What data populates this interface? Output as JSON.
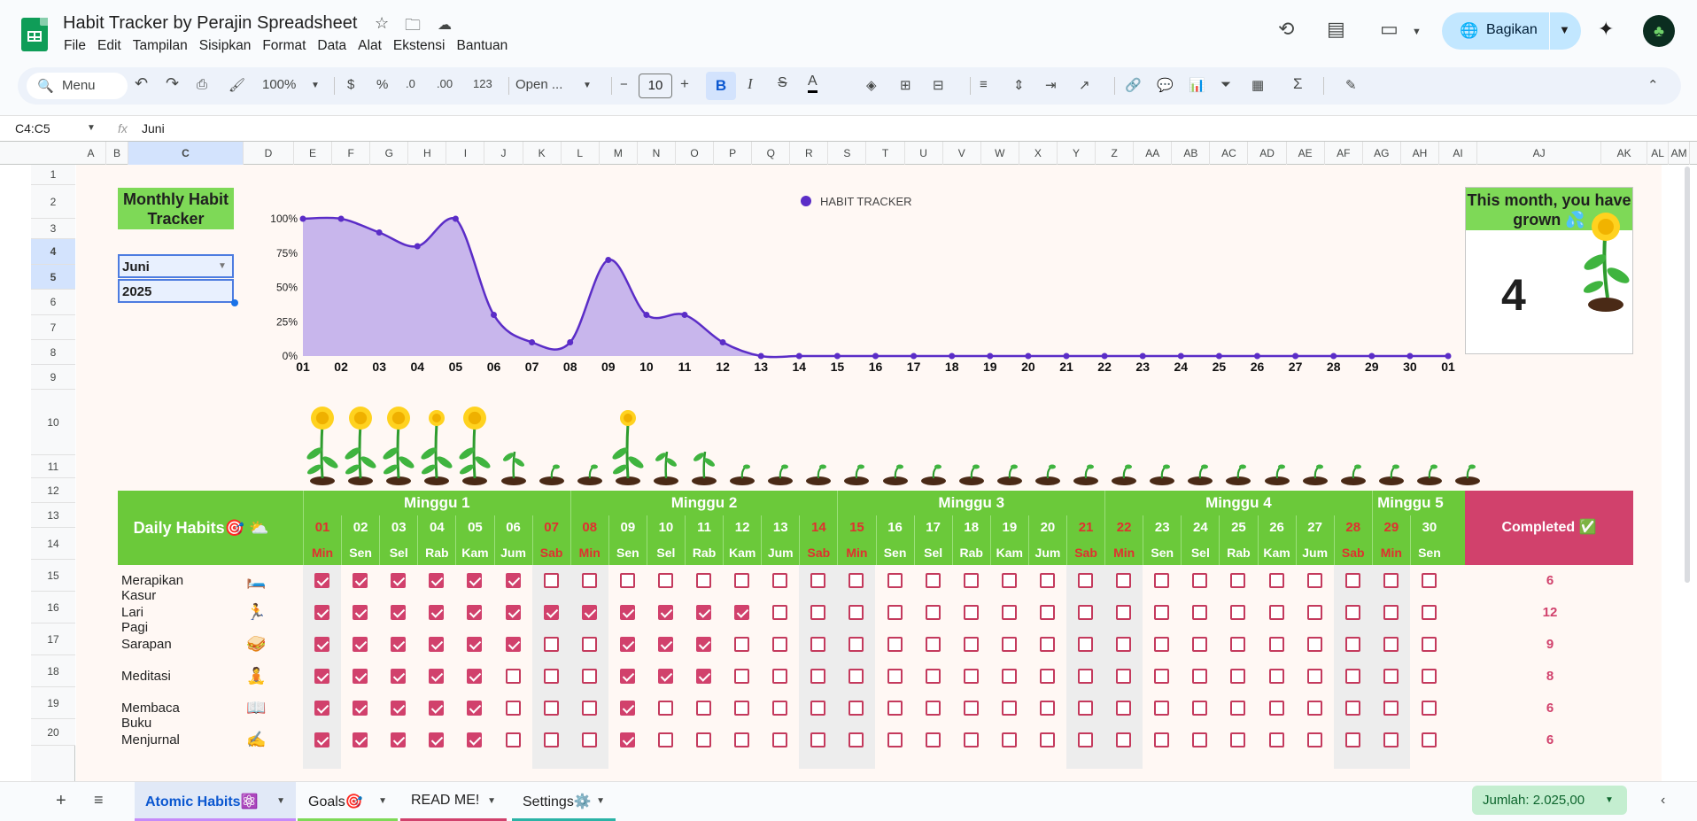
{
  "app": {
    "title": "Habit Tracker by Perajin Spreadsheet",
    "share_label": "Bagikan"
  },
  "menu": [
    "File",
    "Edit",
    "Tampilan",
    "Sisipkan",
    "Format",
    "Data",
    "Alat",
    "Ekstensi",
    "Bantuan"
  ],
  "toolbar": {
    "search": "Menu",
    "zoom": "100%",
    "currency": "$",
    "percent": "%",
    "dec_dec": ".0",
    "dec_inc": ".00",
    "num_fmt": "123",
    "font": "Open ...",
    "font_size": "10"
  },
  "formula": {
    "namebox": "C4:C5",
    "fx": "fx",
    "content": "Juni"
  },
  "columns": [
    "A",
    "B",
    "C",
    "D",
    "E",
    "F",
    "G",
    "H",
    "I",
    "J",
    "K",
    "L",
    "M",
    "N",
    "O",
    "P",
    "Q",
    "R",
    "S",
    "T",
    "U",
    "V",
    "W",
    "X",
    "Y",
    "Z",
    "AA",
    "AB",
    "AC",
    "AD",
    "AE",
    "AF",
    "AG",
    "AH",
    "AI",
    "AJ",
    "AK",
    "AL",
    "AM"
  ],
  "rows": [
    "1",
    "2",
    "3",
    "4",
    "5",
    "6",
    "7",
    "8",
    "9",
    "10",
    "11",
    "12",
    "13",
    "14",
    "15",
    "16",
    "17",
    "18",
    "19",
    "20"
  ],
  "tracker": {
    "title": "Monthly Habit Tracker",
    "month": "Juni",
    "year": "2025",
    "grown_title": "This month, you have grown 💦",
    "grown_value": "4"
  },
  "chart_data": {
    "type": "area",
    "title": "",
    "legend": [
      "HABIT TRACKER"
    ],
    "legend_position": "top-center",
    "x": [
      "01",
      "02",
      "03",
      "04",
      "05",
      "06",
      "07",
      "08",
      "09",
      "10",
      "11",
      "12",
      "13",
      "14",
      "15",
      "16",
      "17",
      "18",
      "19",
      "20",
      "21",
      "22",
      "23",
      "24",
      "25",
      "26",
      "27",
      "28",
      "29",
      "30",
      "01"
    ],
    "series": [
      {
        "name": "HABIT TRACKER",
        "values": [
          100,
          100,
          90,
          80,
          100,
          30,
          10,
          10,
          70,
          30,
          30,
          10,
          0,
          0,
          0,
          0,
          0,
          0,
          0,
          0,
          0,
          0,
          0,
          0,
          0,
          0,
          0,
          0,
          0,
          0,
          0
        ]
      }
    ],
    "yticks": [
      "0%",
      "25%",
      "50%",
      "75%",
      "100%"
    ],
    "ylim": [
      0,
      100
    ],
    "colors": {
      "line": "#5b2dc7",
      "fill": "#c8b6ec"
    }
  },
  "plants": [
    "flower",
    "flower",
    "flower",
    "budflower",
    "flower",
    "sprout",
    "seed",
    "seed",
    "budflower",
    "sprout",
    "sprout",
    "seed",
    "seed",
    "seed",
    "seed",
    "seed",
    "seed",
    "seed",
    "seed",
    "seed",
    "seed",
    "seed",
    "seed",
    "seed",
    "seed",
    "seed",
    "seed",
    "seed",
    "seed",
    "seed",
    "seed"
  ],
  "habits": {
    "header": "Daily Habits🎯 ⛅",
    "completed_label": "Completed ✅",
    "weeks": [
      "Minggu 1",
      "Minggu 2",
      "Minggu 3",
      "Minggu 4",
      "Minggu 5"
    ],
    "week_spans": [
      7,
      7,
      7,
      7,
      2
    ],
    "days": [
      "01",
      "02",
      "03",
      "04",
      "05",
      "06",
      "07",
      "08",
      "09",
      "10",
      "11",
      "12",
      "13",
      "14",
      "15",
      "16",
      "17",
      "18",
      "19",
      "20",
      "21",
      "22",
      "23",
      "24",
      "25",
      "26",
      "27",
      "28",
      "29",
      "30"
    ],
    "weekdays": [
      "Min",
      "Sen",
      "Sel",
      "Rab",
      "Kam",
      "Jum",
      "Sab",
      "Min",
      "Sen",
      "Sel",
      "Rab",
      "Kam",
      "Jum",
      "Sab",
      "Min",
      "Sen",
      "Sel",
      "Rab",
      "Kam",
      "Jum",
      "Sab",
      "Min",
      "Sen",
      "Sel",
      "Rab",
      "Kam",
      "Jum",
      "Sab",
      "Min",
      "Sen"
    ],
    "rows": [
      {
        "name": "Merapikan Kasur",
        "icon": "🛏️",
        "checks": "111111000000000000000000000000",
        "completed": "6"
      },
      {
        "name": "Lari Pagi",
        "icon": "🏃",
        "checks": "111111111111000000000000000000",
        "completed": "12"
      },
      {
        "name": "Sarapan",
        "icon": "🥪",
        "checks": "111111001110000000000000000000",
        "completed": "9"
      },
      {
        "name": "Meditasi",
        "icon": "🧘",
        "checks": "111110001110000000000000000000",
        "completed": "8"
      },
      {
        "name": "Membaca Buku",
        "icon": "📖",
        "checks": "111110001000000000000000000000",
        "completed": "6"
      },
      {
        "name": "Menjurnal",
        "icon": "✍️",
        "checks": "111110001000000000000000000000",
        "completed": "6"
      }
    ]
  },
  "tabs": [
    {
      "label": "Atomic Habits⚛️",
      "active": true,
      "color": "#c58af9"
    },
    {
      "label": "Goals🎯",
      "active": false,
      "color": "#7ed957"
    },
    {
      "label": "READ ME!",
      "active": false,
      "color": "#d1416c"
    },
    {
      "label": "Settings⚙️",
      "active": false,
      "color": "#2bb3a6"
    }
  ],
  "sum": "Jumlah: 2.025,00"
}
